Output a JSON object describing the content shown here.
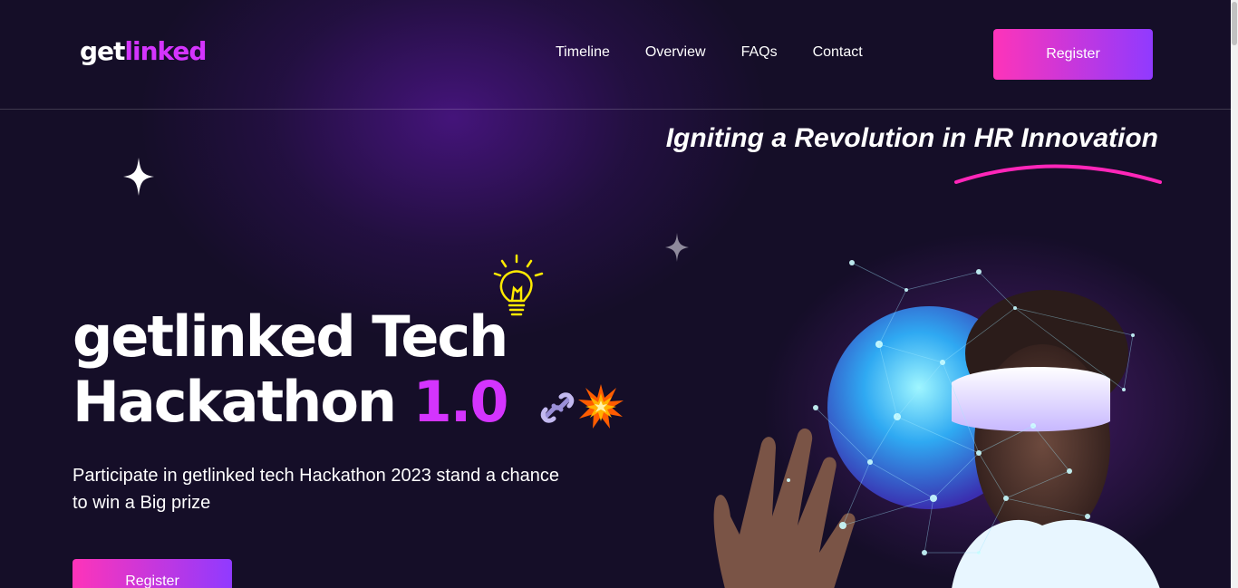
{
  "logo": {
    "part1": "get",
    "part2": "linked"
  },
  "nav": [
    "Timeline",
    "Overview",
    "FAQs",
    "Contact"
  ],
  "header_register": "Register",
  "tagline": "Igniting a Revolution in HR Innovation",
  "hero": {
    "title_line1": "getlinked Tech",
    "title_line2": "Hackathon ",
    "title_accent": "1.0",
    "description": "Participate in getlinked tech Hackathon 2023 stand a chance to win a Big prize",
    "register": "Register"
  },
  "colors": {
    "accent": "#d434fe",
    "gradient_start": "#fe34b9",
    "gradient_end": "#903aff",
    "background": "#150e28"
  },
  "icons": [
    "sparkle-icon",
    "lightbulb-icon",
    "chain-icon",
    "explosion-icon"
  ]
}
